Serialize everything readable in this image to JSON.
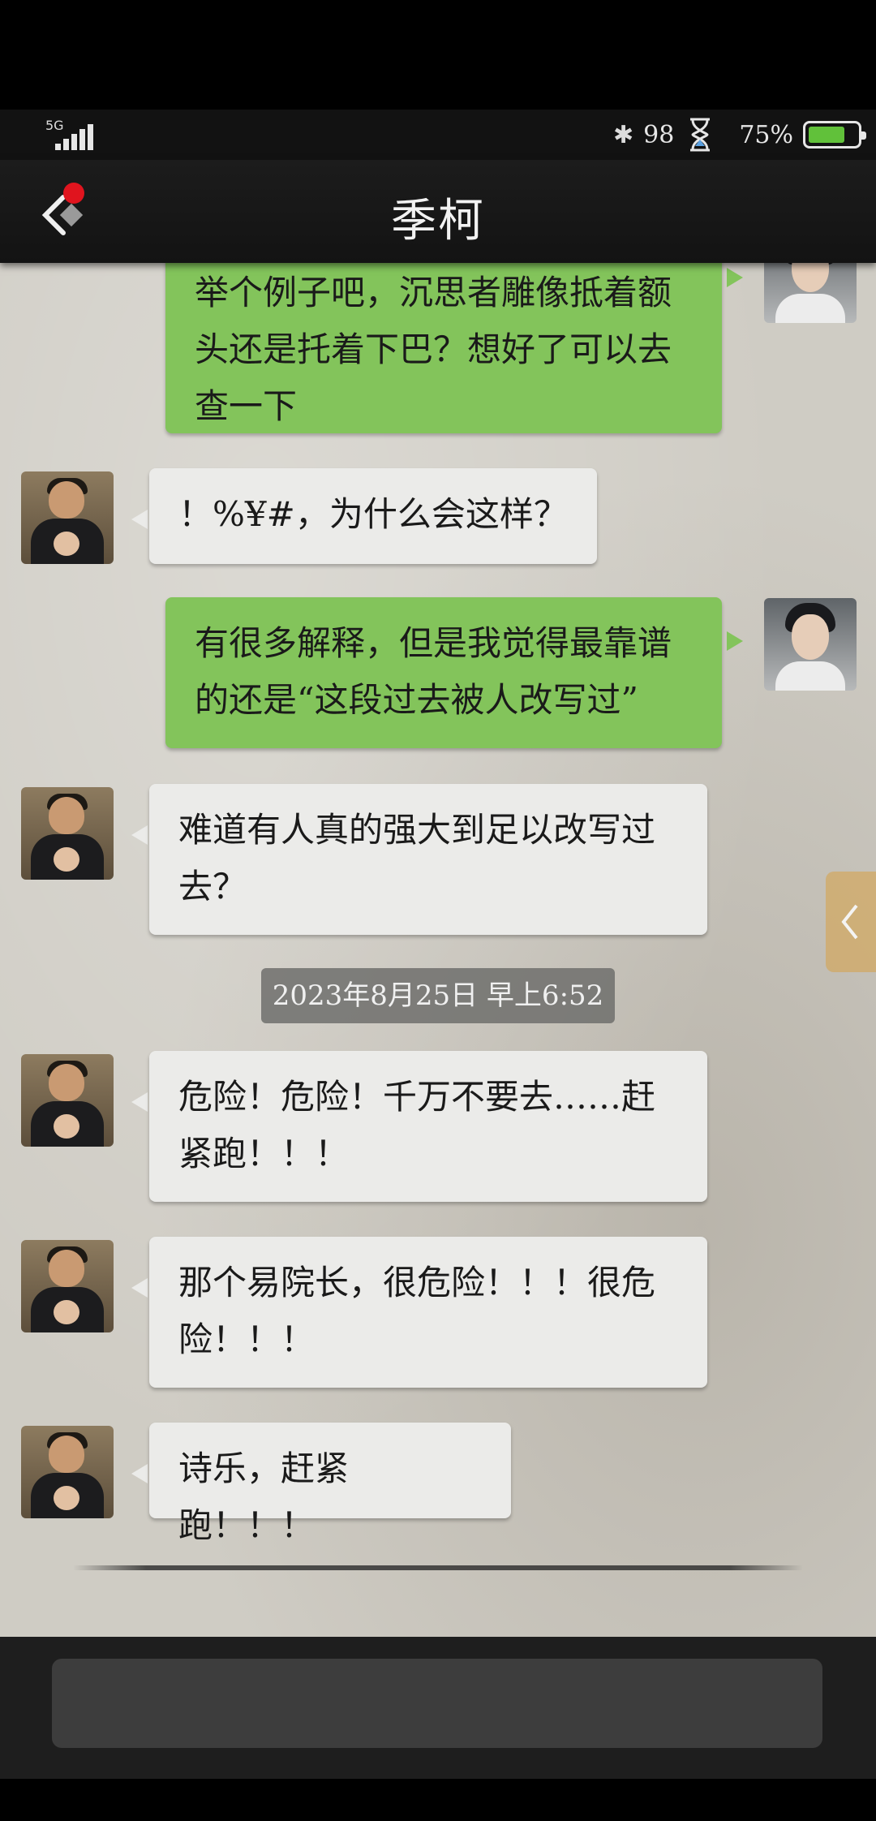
{
  "status_bar": {
    "network": "5G",
    "bluetooth_icon": "bluetooth-icon",
    "signal_value": "98",
    "hourglass_icon": "hourglass-icon",
    "battery_percent": "75%",
    "battery_level": 0.75,
    "battery_color": "#61c13a"
  },
  "header": {
    "title": "季柯",
    "back_icon": "back-chevron-icon",
    "notification_dot_color": "#e0141e"
  },
  "messages": [
    {
      "sender": "me",
      "text_lines": [
        "举个例子吧，沉思者雕像抵着额",
        "头还是托着下巴？想好了可以去",
        "查一下"
      ]
    },
    {
      "sender": "them",
      "text_lines": [
        "！%¥#，为什么会这样？"
      ]
    },
    {
      "sender": "me",
      "text_lines": [
        "有很多解释，但是我觉得最靠谱",
        "的还是“这段过去被人改写过”"
      ]
    },
    {
      "sender": "them",
      "text_lines": [
        "难道有人真的强大到足以改写过",
        "去？"
      ]
    },
    {
      "sender": "them",
      "text_lines": [
        "危险！危险！千万不要去……赶",
        "紧跑！！！"
      ]
    },
    {
      "sender": "them",
      "text_lines": [
        "那个易院长，很危险！！！很危",
        "险！！！"
      ]
    },
    {
      "sender": "them",
      "text_lines": [
        "诗乐，赶紧跑！！！"
      ]
    }
  ],
  "timestamp": "2023年8月25日 早上6:52",
  "side_tab_icon": "chevron-left-icon",
  "input": {
    "value": "",
    "placeholder": ""
  }
}
